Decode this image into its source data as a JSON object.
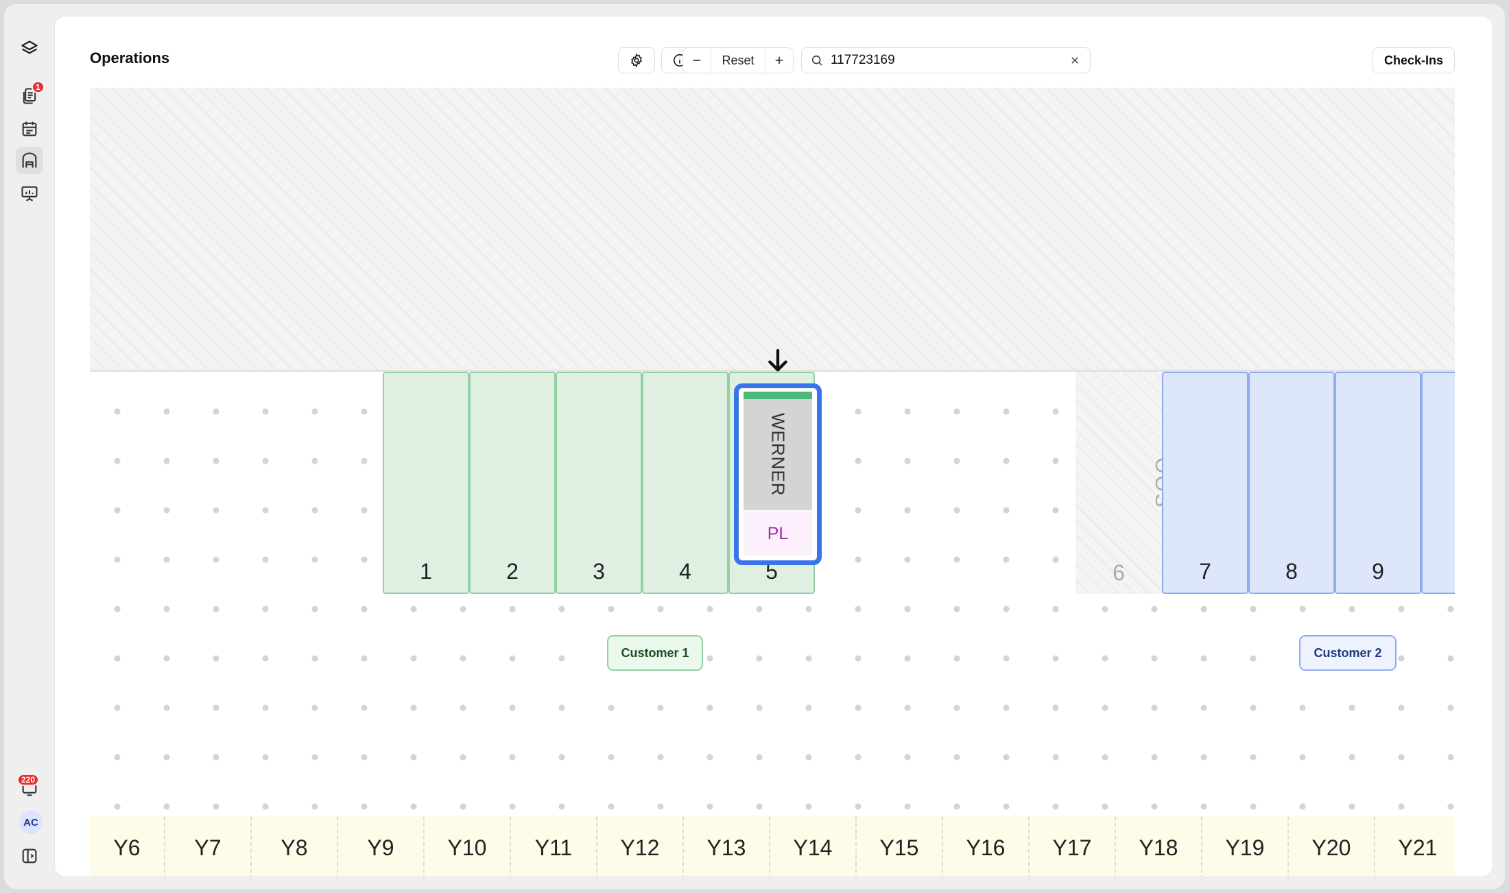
{
  "sidebar": {
    "items": [
      {
        "icon": "layers-logo-icon"
      },
      {
        "icon": "documents-icon",
        "badge": "1"
      },
      {
        "icon": "calendar-icon"
      },
      {
        "icon": "warehouse-icon"
      },
      {
        "icon": "presentation-chart-icon"
      }
    ],
    "notifications_badge": "220",
    "avatar": "AC"
  },
  "header": {
    "title": "Operations",
    "zoom_reset_label": "Reset",
    "search_value": "117723169",
    "checkins_label": "Check-Ins"
  },
  "doors": [
    {
      "number": "1",
      "status": "customer-1"
    },
    {
      "number": "2",
      "status": "customer-1"
    },
    {
      "number": "3",
      "status": "customer-1"
    },
    {
      "number": "4",
      "status": "customer-1"
    },
    {
      "number": "5",
      "status": "customer-1"
    },
    {
      "number": "6",
      "status": "oos"
    },
    {
      "number": "7",
      "status": "customer-2"
    },
    {
      "number": "8",
      "status": "customer-2"
    },
    {
      "number": "9",
      "status": "customer-2"
    }
  ],
  "oos_label": "OOS",
  "trailer": {
    "carrier": "WERNER",
    "tag": "PL",
    "stripe_color": "#4cb87b",
    "highlight_color": "#3a74ea"
  },
  "customers": [
    {
      "label": "Customer 1",
      "color": "#92d0a2"
    },
    {
      "label": "Customer 2",
      "color": "#90abf0"
    }
  ],
  "yard_slots": [
    "Y6",
    "Y7",
    "Y8",
    "Y9",
    "Y10",
    "Y11",
    "Y12",
    "Y13",
    "Y14",
    "Y15",
    "Y16",
    "Y17",
    "Y18",
    "Y19",
    "Y20",
    "Y21"
  ]
}
